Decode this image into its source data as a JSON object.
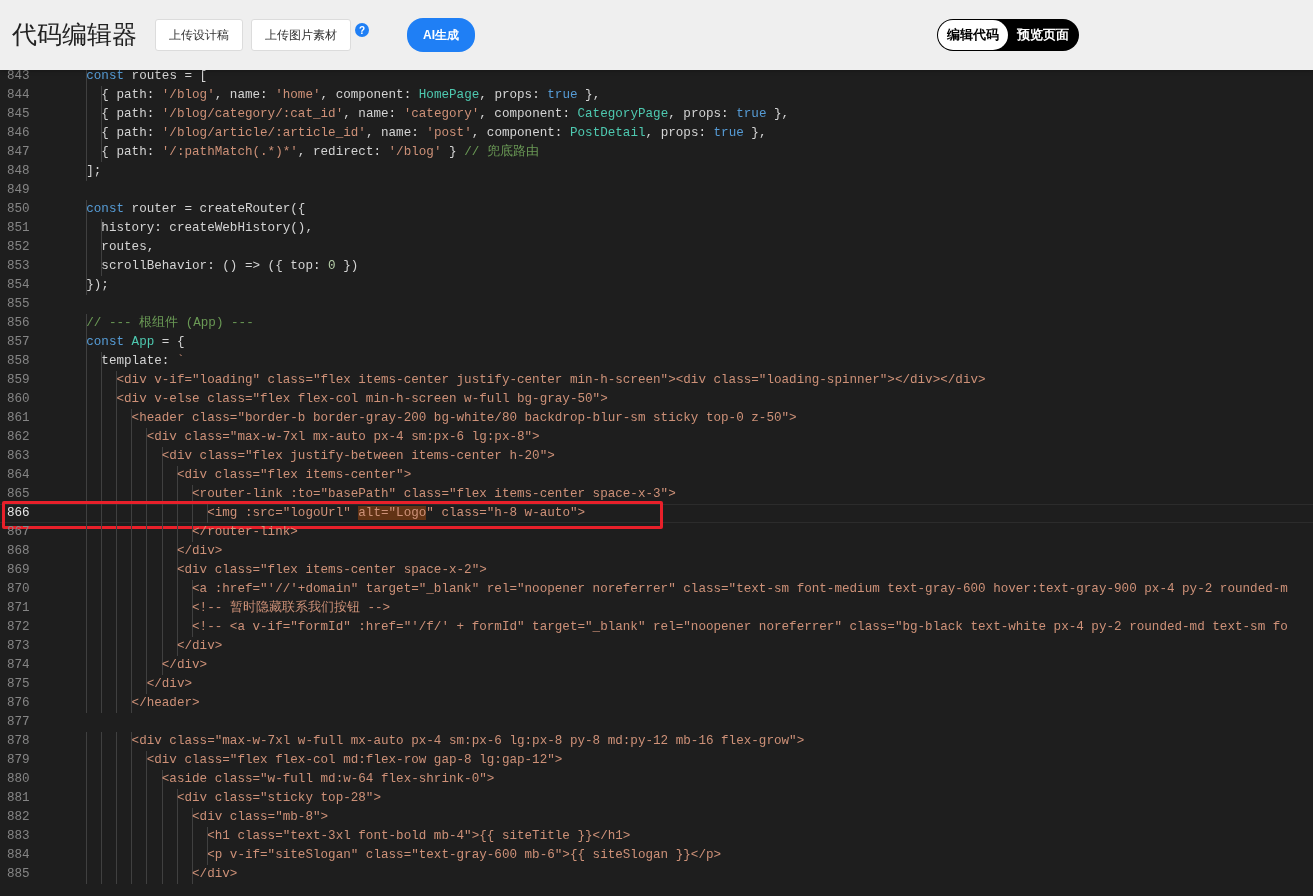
{
  "header": {
    "title": "代码编辑器",
    "buttons": [
      "上传设计稿",
      "上传图片素材"
    ],
    "help": "?",
    "ai_button": "AI生成",
    "mode_toggle": [
      {
        "label": "编辑代码",
        "selected": true
      },
      {
        "label": "预览页面",
        "selected": false
      }
    ]
  },
  "editor": {
    "lines": [
      {
        "number": "843",
        "highlighted": false,
        "tokens": [
          {
            "kind": "keyword",
            "text": "    const"
          },
          {
            "kind": "plain",
            "text": " routes = ["
          }
        ]
      },
      {
        "number": "844",
        "highlighted": false,
        "tokens": [
          {
            "kind": "plain",
            "text": "      { path: "
          },
          {
            "kind": "string",
            "text": "'/blog'"
          },
          {
            "kind": "plain",
            "text": ", name: "
          },
          {
            "kind": "string",
            "text": "'home'"
          },
          {
            "kind": "plain",
            "text": ", component: "
          },
          {
            "kind": "type",
            "text": "HomePage"
          },
          {
            "kind": "plain",
            "text": ", props: "
          },
          {
            "kind": "keyword",
            "text": "true"
          },
          {
            "kind": "plain",
            "text": " },"
          }
        ]
      },
      {
        "number": "845",
        "highlighted": false,
        "tokens": [
          {
            "kind": "plain",
            "text": "      { path: "
          },
          {
            "kind": "string",
            "text": "'/blog/category/:cat_id'"
          },
          {
            "kind": "plain",
            "text": ", name: "
          },
          {
            "kind": "string",
            "text": "'category'"
          },
          {
            "kind": "plain",
            "text": ", component: "
          },
          {
            "kind": "type",
            "text": "CategoryPage"
          },
          {
            "kind": "plain",
            "text": ", props: "
          },
          {
            "kind": "keyword",
            "text": "true"
          },
          {
            "kind": "plain",
            "text": " },"
          }
        ]
      },
      {
        "number": "846",
        "highlighted": false,
        "tokens": [
          {
            "kind": "plain",
            "text": "      { path: "
          },
          {
            "kind": "string",
            "text": "'/blog/article/:article_id'"
          },
          {
            "kind": "plain",
            "text": ", name: "
          },
          {
            "kind": "string",
            "text": "'post'"
          },
          {
            "kind": "plain",
            "text": ", component: "
          },
          {
            "kind": "type",
            "text": "PostDetail"
          },
          {
            "kind": "plain",
            "text": ", props: "
          },
          {
            "kind": "keyword",
            "text": "true"
          },
          {
            "kind": "plain",
            "text": " },"
          }
        ]
      },
      {
        "number": "847",
        "highlighted": false,
        "tokens": [
          {
            "kind": "plain",
            "text": "      { path: "
          },
          {
            "kind": "string",
            "text": "'/:pathMatch(.*)*'"
          },
          {
            "kind": "plain",
            "text": ", redirect: "
          },
          {
            "kind": "string",
            "text": "'/blog'"
          },
          {
            "kind": "plain",
            "text": " } "
          },
          {
            "kind": "comment",
            "text": "// 兜底路由"
          }
        ]
      },
      {
        "number": "848",
        "highlighted": false,
        "tokens": [
          {
            "kind": "plain",
            "text": "    ];"
          }
        ]
      },
      {
        "number": "849",
        "highlighted": false
      },
      {
        "number": "850",
        "highlighted": false,
        "tokens": [
          {
            "kind": "keyword",
            "text": "    const"
          },
          {
            "kind": "plain",
            "text": " router = createRouter({"
          }
        ]
      },
      {
        "number": "851",
        "highlighted": false,
        "tokens": [
          {
            "kind": "plain",
            "text": "      history: createWebHistory(),"
          }
        ]
      },
      {
        "number": "852",
        "highlighted": false,
        "tokens": [
          {
            "kind": "plain",
            "text": "      routes,"
          }
        ]
      },
      {
        "number": "853",
        "highlighted": false,
        "tokens": [
          {
            "kind": "plain",
            "text": "      scrollBehavior: () => ({ top: "
          },
          {
            "kind": "number",
            "text": "0"
          },
          {
            "kind": "plain",
            "text": " })"
          }
        ]
      },
      {
        "number": "854",
        "highlighted": false,
        "tokens": [
          {
            "kind": "plain",
            "text": "    });"
          }
        ]
      },
      {
        "number": "855",
        "highlighted": false
      },
      {
        "number": "856",
        "highlighted": false,
        "tokens": [
          {
            "kind": "comment",
            "text": "    // --- 根组件 (App) ---"
          }
        ]
      },
      {
        "number": "857",
        "highlighted": false,
        "tokens": [
          {
            "kind": "keyword",
            "text": "    const"
          },
          {
            "kind": "type",
            "text": " App"
          },
          {
            "kind": "plain",
            "text": " = {"
          }
        ]
      },
      {
        "number": "858",
        "highlighted": false,
        "tokens": [
          {
            "kind": "plain",
            "text": "      template: "
          },
          {
            "kind": "string",
            "text": "`"
          }
        ]
      },
      {
        "number": "859",
        "highlighted": false,
        "tokens": [
          {
            "kind": "string",
            "text": "        <div v-if=\"loading\" class=\"flex items-center justify-center min-h-screen\"><div class=\"loading-spinner\"></div></div>"
          }
        ]
      },
      {
        "number": "860",
        "highlighted": false,
        "tokens": [
          {
            "kind": "string",
            "text": "        <div v-else class=\"flex flex-col min-h-screen w-full bg-gray-50\">"
          }
        ]
      },
      {
        "number": "861",
        "highlighted": false,
        "tokens": [
          {
            "kind": "string",
            "text": "          <header class=\"border-b border-gray-200 bg-white/80 backdrop-blur-sm sticky top-0 z-50\">"
          }
        ]
      },
      {
        "number": "862",
        "highlighted": false,
        "tokens": [
          {
            "kind": "string",
            "text": "            <div class=\"max-w-7xl mx-auto px-4 sm:px-6 lg:px-8\">"
          }
        ]
      },
      {
        "number": "863",
        "highlighted": false,
        "tokens": [
          {
            "kind": "string",
            "text": "              <div class=\"flex justify-between items-center h-20\">"
          }
        ]
      },
      {
        "number": "864",
        "highlighted": false,
        "tokens": [
          {
            "kind": "string",
            "text": "                <div class=\"flex items-center\">"
          }
        ]
      },
      {
        "number": "865",
        "highlighted": false,
        "tokens": [
          {
            "kind": "string",
            "text": "                  <router-link :to=\"basePath\" class=\"flex items-center space-x-3\">"
          }
        ]
      },
      {
        "number": "866",
        "highlighted": true,
        "tokens": [
          {
            "kind": "string",
            "text": "                    <img :src=\"logoUrl\" "
          },
          {
            "kind": "match",
            "text": "alt=\"Logo"
          },
          {
            "kind": "string",
            "text": "\" class=\"h-8 w-auto\">"
          }
        ]
      },
      {
        "number": "867",
        "highlighted": false,
        "tokens": [
          {
            "kind": "string",
            "text": "                  </router-link>"
          }
        ]
      },
      {
        "number": "868",
        "highlighted": false,
        "tokens": [
          {
            "kind": "string",
            "text": "                </div>"
          }
        ]
      },
      {
        "number": "869",
        "highlighted": false,
        "tokens": [
          {
            "kind": "string",
            "text": "                <div class=\"flex items-center space-x-2\">"
          }
        ]
      },
      {
        "number": "870",
        "highlighted": false,
        "tokens": [
          {
            "kind": "string",
            "text": "                  <a :href=\"'//'+domain\" target=\"_blank\" rel=\"noopener noreferrer\" class=\"text-sm font-medium text-gray-600 hover:text-gray-900 px-4 py-2 rounded-m"
          }
        ]
      },
      {
        "number": "871",
        "highlighted": false,
        "tokens": [
          {
            "kind": "string",
            "text": "                  <!-- 暂时隐藏联系我们按钮 -->"
          }
        ]
      },
      {
        "number": "872",
        "highlighted": false,
        "tokens": [
          {
            "kind": "string",
            "text": "                  <!-- <a v-if=\"formId\" :href=\"'/f/' + formId\" target=\"_blank\" rel=\"noopener noreferrer\" class=\"bg-black text-white px-4 py-2 rounded-md text-sm fo"
          }
        ]
      },
      {
        "number": "873",
        "highlighted": false,
        "tokens": [
          {
            "kind": "string",
            "text": "                </div>"
          }
        ]
      },
      {
        "number": "874",
        "highlighted": false,
        "tokens": [
          {
            "kind": "string",
            "text": "              </div>"
          }
        ]
      },
      {
        "number": "875",
        "highlighted": false,
        "tokens": [
          {
            "kind": "string",
            "text": "            </div>"
          }
        ]
      },
      {
        "number": "876",
        "highlighted": false,
        "tokens": [
          {
            "kind": "string",
            "text": "          </header>"
          }
        ]
      },
      {
        "number": "877",
        "highlighted": false
      },
      {
        "number": "878",
        "highlighted": false,
        "tokens": [
          {
            "kind": "string",
            "text": "          <div class=\"max-w-7xl w-full mx-auto px-4 sm:px-6 lg:px-8 py-8 md:py-12 mb-16 flex-grow\">"
          }
        ]
      },
      {
        "number": "879",
        "highlighted": false,
        "tokens": [
          {
            "kind": "string",
            "text": "            <div class=\"flex flex-col md:flex-row gap-8 lg:gap-12\">"
          }
        ]
      },
      {
        "number": "880",
        "highlighted": false,
        "tokens": [
          {
            "kind": "string",
            "text": "              <aside class=\"w-full md:w-64 flex-shrink-0\">"
          }
        ]
      },
      {
        "number": "881",
        "highlighted": false,
        "tokens": [
          {
            "kind": "string",
            "text": "                <div class=\"sticky top-28\">"
          }
        ]
      },
      {
        "number": "882",
        "highlighted": false,
        "tokens": [
          {
            "kind": "string",
            "text": "                  <div class=\"mb-8\">"
          }
        ]
      },
      {
        "number": "883",
        "highlighted": false,
        "tokens": [
          {
            "kind": "string",
            "text": "                    <h1 class=\"text-3xl font-bold mb-4\">{{ siteTitle }}</h1>"
          }
        ]
      },
      {
        "number": "884",
        "highlighted": false,
        "tokens": [
          {
            "kind": "string",
            "text": "                    <p v-if=\"siteSlogan\" class=\"text-gray-600 mb-6\">{{ siteSlogan }}</p>"
          }
        ]
      },
      {
        "number": "885",
        "highlighted": false,
        "tokens": [
          {
            "kind": "string",
            "text": "                  </div>"
          }
        ]
      }
    ]
  }
}
